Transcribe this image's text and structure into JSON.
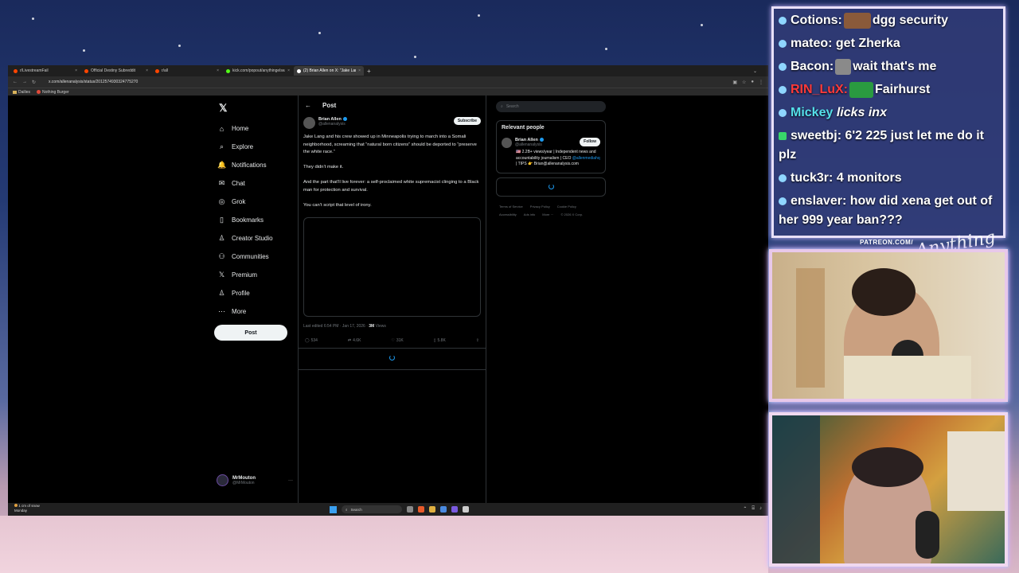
{
  "browser": {
    "tabs": [
      {
        "label": "r/LivestreamFail",
        "active": false,
        "fav_color": "#ff4500"
      },
      {
        "label": "Official Destiny Subreddit",
        "active": false,
        "fav_color": "#ff4500"
      },
      {
        "label": "r/all",
        "active": false,
        "fav_color": "#ff4500"
      },
      {
        "label": "kick.com/popout/anythingelse/",
        "active": false,
        "fav_color": "#53fc18"
      },
      {
        "label": "(2) Brian Allen on X: \"Jake Lang",
        "active": true,
        "fav_color": "#ffffff"
      }
    ],
    "url": "x.com/allenanalysis/status/2012574930324775270",
    "bookmarks": [
      {
        "label": "Dailies",
        "icon": "folder-icon"
      },
      {
        "label": "Nothing Burger",
        "icon": "circle-icon"
      }
    ]
  },
  "x": {
    "nav": [
      {
        "label": "Home",
        "icon": "⌂"
      },
      {
        "label": "Explore",
        "icon": "⌕"
      },
      {
        "label": "Notifications",
        "icon": "🔔"
      },
      {
        "label": "Chat",
        "icon": "✉"
      },
      {
        "label": "Grok",
        "icon": "◎"
      },
      {
        "label": "Bookmarks",
        "icon": "▯"
      },
      {
        "label": "Creator Studio",
        "icon": "♙"
      },
      {
        "label": "Communities",
        "icon": "⚇"
      },
      {
        "label": "Premium",
        "icon": "𝕏"
      },
      {
        "label": "Profile",
        "icon": "♙"
      },
      {
        "label": "More",
        "icon": "⋯"
      }
    ],
    "post_button": "Post",
    "account": {
      "name": "MrMouton",
      "handle": "@MrMouton"
    },
    "post": {
      "header": "Post",
      "author_name": "Brian Allen",
      "author_handle": "@allenanalysis",
      "subscribe": "Subscribe",
      "paragraphs": [
        "Jake Lang and his crew showed up in Minneapolis trying to march into a Somali neighborhood, screaming that “natural born citizens” should be deported to “preserve the white race.”",
        "They didn’t make it.",
        "And the part that’ll live forever: a self-proclaimed white supremacist clinging to a Black man for protection and survival.",
        "You can’t script that level of irony."
      ],
      "meta_prefix": "Last edited 6:54 PM · Jan 17, 2026 · ",
      "views": "3M",
      "views_label": " Views",
      "stats": {
        "replies": "534",
        "reposts": "4.6K",
        "likes": "31K",
        "bookmarks": "5.8K"
      }
    },
    "right": {
      "search_placeholder": "Search",
      "relevant_title": "Relevant people",
      "person_name": "Brian Allen",
      "person_handle": "@allenanalysis",
      "follow": "Follow",
      "bio_1": "🇺🇸 2.2B+ views/year | Independent news and accountability journalism | CEO ",
      "bio_link": "@allenmediahq",
      "bio_2": " | TIPS 👉 Brian@allenanalysis.com",
      "footer": [
        "Terms of Service",
        "Privacy Policy",
        "Cookie Policy",
        "Accessibility",
        "Ads info",
        "More ···",
        "© 2026 X Corp."
      ]
    }
  },
  "taskbar": {
    "weather_line1": "1 cm of snow",
    "weather_line2": "Monday",
    "search": "Search"
  },
  "chat": [
    {
      "user": "Cotions:",
      "text": "dgg security",
      "user_color": "#ffffff",
      "emote": "emote",
      "badge": "blue"
    },
    {
      "user": "mateo:",
      "text": "get Zherka",
      "user_color": "#ffffff",
      "badge": "blue"
    },
    {
      "user": "Bacon:",
      "text": "wait that's me",
      "user_color": "#ffffff",
      "emote": "face",
      "badge": "blue"
    },
    {
      "user": "RIN_LuX:",
      "text": "Fairhurst",
      "user_color": "#ff3a3a",
      "emote": "flag",
      "badge": "blue"
    },
    {
      "user": "Mickey",
      "text": "licks inx",
      "user_color": "#55e0ea",
      "italic": true,
      "badge": "blue"
    },
    {
      "user": "sweetbj:",
      "text": "6'2 225 just let me do it plz",
      "user_color": "#ffffff",
      "badge": "green"
    },
    {
      "user": "tuck3r:",
      "text": "4 monitors",
      "user_color": "#ffffff",
      "badge": "blue"
    },
    {
      "user": "enslaver:",
      "text": "how did xena get out of her 999 year ban???",
      "user_color": "#ffffff",
      "badge": "blue"
    }
  ],
  "overlay": {
    "patreon": "PATREON.COM/",
    "script_logo": "Anything Else?"
  }
}
